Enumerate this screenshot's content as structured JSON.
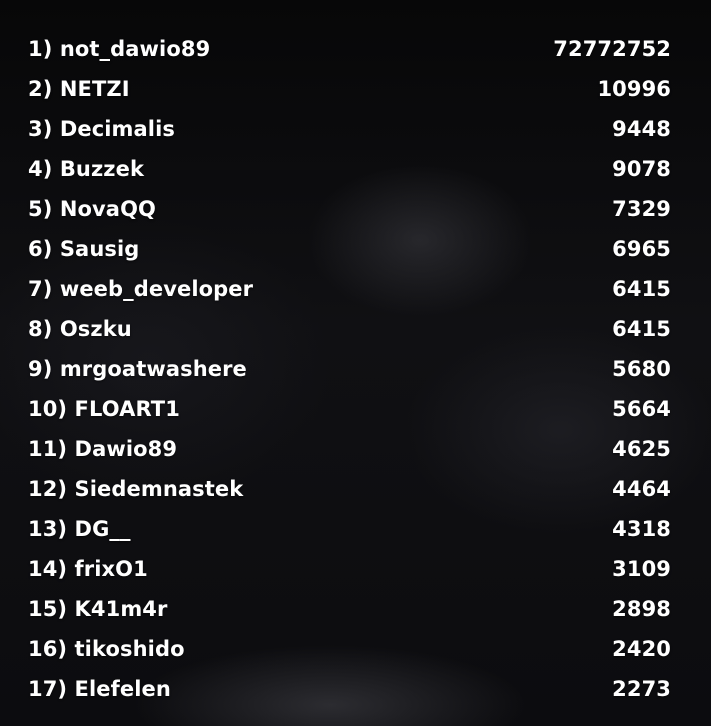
{
  "leaderboard": {
    "entries": [
      {
        "label": "1) not_dawio89",
        "score": "72772752"
      },
      {
        "label": "2) NETZI",
        "score": "10996"
      },
      {
        "label": "3) Decimalis",
        "score": "9448"
      },
      {
        "label": "4) Buzzek",
        "score": "9078"
      },
      {
        "label": "5) NovaQQ",
        "score": "7329"
      },
      {
        "label": "6) Sausig",
        "score": "6965"
      },
      {
        "label": "7) weeb_developer",
        "score": "6415"
      },
      {
        "label": "8) Oszku",
        "score": "6415"
      },
      {
        "label": "9) mrgoatwashere",
        "score": "5680"
      },
      {
        "label": "10) FLOART1",
        "score": "5664"
      },
      {
        "label": "11) Dawio89",
        "score": "4625"
      },
      {
        "label": "12) Siedemnastek",
        "score": "4464"
      },
      {
        "label": "13) DG__",
        "score": "4318"
      },
      {
        "label": "14) frixO1",
        "score": "3109"
      },
      {
        "label": "15) K41m4r",
        "score": "2898"
      },
      {
        "label": "16) tikoshido",
        "score": "2420"
      },
      {
        "label": "17) Elefelen",
        "score": "2273"
      }
    ]
  }
}
